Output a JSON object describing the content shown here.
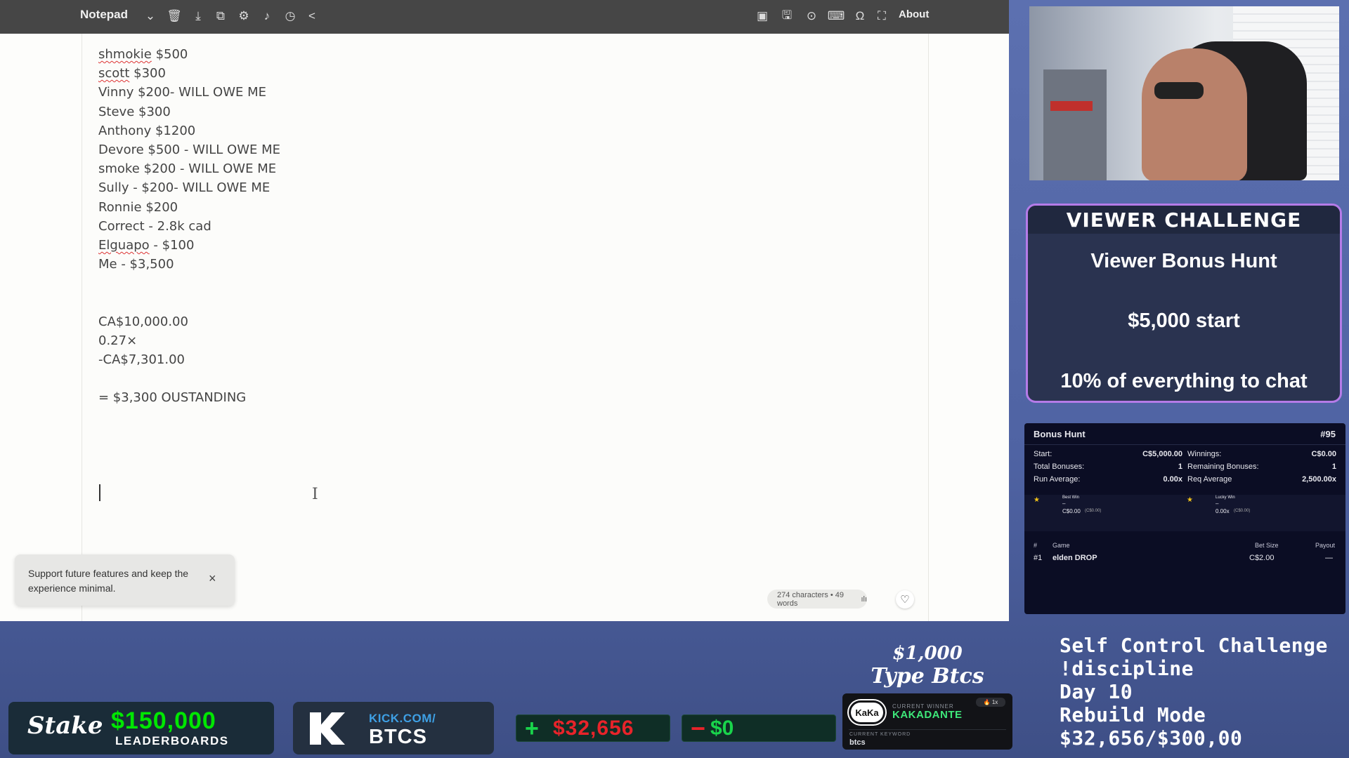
{
  "notepad": {
    "title": "Notepad",
    "about_label": "About",
    "lines": [
      "shmokie $500",
      "scott $300",
      "Vinny $200- WILL OWE ME",
      "Steve $300",
      "Anthony $1200",
      "Devore $500 - WILL OWE ME",
      "smoke $200 - WILL OWE ME",
      "Sully - $200- WILL OWE ME",
      "Ronnie $200",
      "Correct - 2.8k cad",
      "Elguapo - $100",
      "Me - $3,500",
      "",
      "",
      "CA$10,000.00",
      "0.27×",
      "-CA$7,301.00",
      "",
      "= $3,300 OUSTANDING"
    ],
    "toast_message": "Support future features and keep the experience minimal.",
    "toast_close": "×",
    "stats": "274 characters • 49 words"
  },
  "viewer_challenge": {
    "heading": "VIEWER CHALLENGE",
    "line1": "Viewer Bonus Hunt",
    "line2": "$5,000 start",
    "line3": "10% of everything to chat"
  },
  "bonus_hunt": {
    "title": "Bonus Hunt",
    "number": "#95",
    "start_label": "Start:",
    "start_value": "C$5,000.00",
    "winnings_label": "Winnings:",
    "winnings_value": "C$0.00",
    "total_bonuses_label": "Total Bonuses:",
    "total_bonuses_value": "1",
    "remaining_label": "Remaining Bonuses:",
    "remaining_value": "1",
    "run_avg_label": "Run Average:",
    "run_avg_value": "0.00x",
    "req_avg_label": "Req Average",
    "req_avg_value": "2,500.00x",
    "best_win_label": "Best Win",
    "best_win_dash": "–",
    "best_win_value": "C$0.00",
    "best_win_sub": "(C$0.00)",
    "lucky_win_label": "Lucky Win",
    "lucky_win_dash": "–",
    "lucky_win_value": "0.00x",
    "lucky_win_sub": "(C$0.00)",
    "col_num": "#",
    "col_game": "Game",
    "col_bet": "Bet Size",
    "col_payout": "Payout",
    "row_num": "#1",
    "row_game": "elden DROP",
    "row_bet": "C$2.00",
    "row_payout": "—"
  },
  "self_control": {
    "l1": "Self Control Challenge",
    "l2": "!discipline",
    "l3": "Day 10",
    "l4": "Rebuild Mode",
    "l5": "$32,656/$300,00"
  },
  "promo": {
    "l1": "$1,000",
    "l2": "Type Btcs"
  },
  "stake": {
    "logo": "Stake",
    "amount": "$150,000",
    "sub": "LEADERBOARDS"
  },
  "kick": {
    "url": "KICK.COM/",
    "channel": "BTCS"
  },
  "profit": {
    "plus_sign": "+",
    "plus_value": "$32,656",
    "minus_sign": "−",
    "minus_value": "$0"
  },
  "kaka": {
    "badge": "KaKa",
    "current_winner_label": "CURRENT WINNER",
    "winner": "KAKADANTE",
    "pill": "🔥 1x",
    "keyword_label": "CURRENT KEYWORD",
    "keyword": "btcs"
  }
}
